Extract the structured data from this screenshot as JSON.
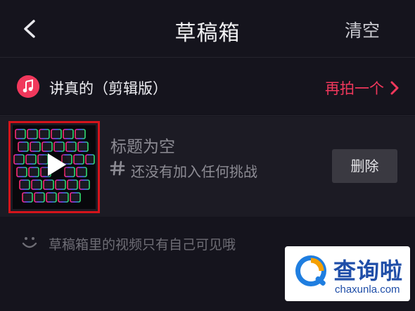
{
  "header": {
    "title": "草稿箱",
    "clear_label": "清空"
  },
  "music": {
    "label": "讲真的（剪辑版）",
    "reshoot_label": "再拍一个"
  },
  "draft": {
    "title": "标题为空",
    "tags": "还没有加入任何挑战",
    "delete_label": "删除"
  },
  "note": "草稿箱里的视频只有自己可见哦",
  "watermark": {
    "text": "查询啦",
    "sub": "chaxunla.com"
  },
  "colors": {
    "accent": "#f0385c",
    "highlight_frame": "#d4141b",
    "background": "#15141d"
  },
  "icons": [
    "back-icon",
    "music-note-icon",
    "chevron-right-icon",
    "play-icon",
    "hashtag-icon",
    "smile-icon",
    "search-logo-icon"
  ]
}
